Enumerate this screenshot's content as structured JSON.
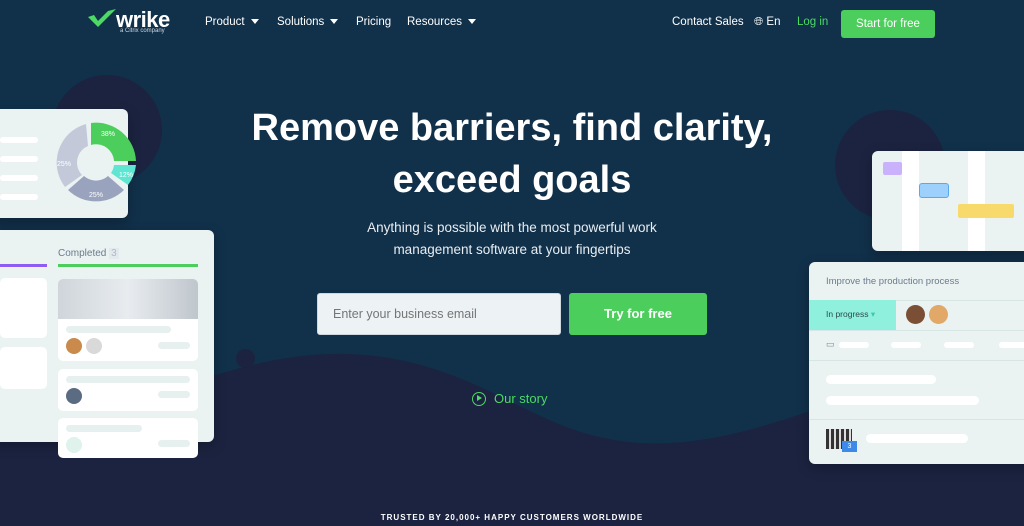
{
  "nav": {
    "logo": "wrike",
    "logo_sub": "a Citrix company",
    "items": [
      {
        "label": "Product",
        "dropdown": true
      },
      {
        "label": "Solutions",
        "dropdown": true
      },
      {
        "label": "Pricing",
        "dropdown": false
      },
      {
        "label": "Resources",
        "dropdown": true
      }
    ],
    "contact": "Contact Sales",
    "language": "En",
    "login": "Log in",
    "start": "Start for free"
  },
  "hero": {
    "title_line1": "Remove barriers, find clarity,",
    "title_line2": "exceed goals",
    "subtitle_line1": "Anything is possible with the most powerful work",
    "subtitle_line2": "management software at your fingertips",
    "email_placeholder": "Enter your business email",
    "cta": "Try for free",
    "story": "Our story"
  },
  "chart_card": {
    "slices": [
      "38%",
      "12%",
      "25%",
      "25%"
    ]
  },
  "board_card": {
    "column": "Completed",
    "count": "3"
  },
  "task_card": {
    "title": "Improve the production process",
    "status": "In progress",
    "comment_count": "3"
  },
  "trusted": "TRUSTED BY 20,000+ HAPPY CUSTOMERS WORLDWIDE",
  "colors": {
    "accent": "#4cce5c",
    "background": "#11304a",
    "wave": "#1b2340",
    "status": "#8ff0de"
  }
}
